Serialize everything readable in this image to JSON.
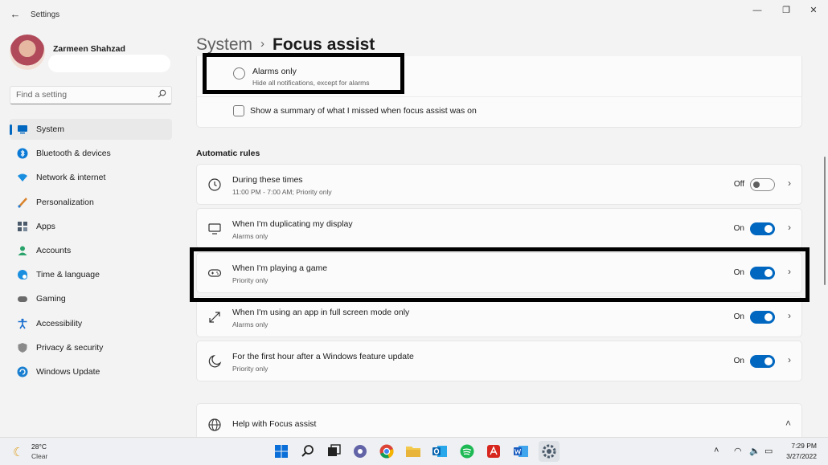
{
  "window": {
    "app_title": "Settings",
    "back_glyph": "←",
    "minimize_glyph": "—",
    "restore_glyph": "❐",
    "close_glyph": "✕"
  },
  "user": {
    "name": "Zarmeen Shahzad"
  },
  "search": {
    "placeholder": "Find a setting",
    "icon": "search-icon"
  },
  "nav": {
    "items": [
      {
        "label": "System",
        "icon": "monitor-icon",
        "color": "#0067c0",
        "active": true
      },
      {
        "label": "Bluetooth & devices",
        "icon": "bluetooth-icon",
        "color": "#0a7ad6"
      },
      {
        "label": "Network & internet",
        "icon": "wifi-icon",
        "color": "#1a8fe0"
      },
      {
        "label": "Personalization",
        "icon": "brush-icon",
        "color": "#d9822b"
      },
      {
        "label": "Apps",
        "icon": "apps-icon",
        "color": "#4a5a6a"
      },
      {
        "label": "Accounts",
        "icon": "person-icon",
        "color": "#2aa36b"
      },
      {
        "label": "Time & language",
        "icon": "globe-clock-icon",
        "color": "#1a8fe0"
      },
      {
        "label": "Gaming",
        "icon": "controller-icon",
        "color": "#6a6a6a"
      },
      {
        "label": "Accessibility",
        "icon": "accessibility-icon",
        "color": "#1a6fd0"
      },
      {
        "label": "Privacy & security",
        "icon": "shield-icon",
        "color": "#8a8a8a"
      },
      {
        "label": "Windows Update",
        "icon": "update-icon",
        "color": "#1a7fd0"
      }
    ]
  },
  "header": {
    "parent": "System",
    "separator": "›",
    "current": "Focus assist"
  },
  "priority_options": {
    "alarms_title": "Alarms only",
    "alarms_sub": "Hide all notifications, except for alarms",
    "summary_label": "Show a summary of what I missed when focus assist was on"
  },
  "automatic_rules": {
    "title": "Automatic rules",
    "rules": [
      {
        "title": "During these times",
        "sub": "11:00 PM - 7:00 AM; Priority only",
        "state": "Off",
        "on": false,
        "icon": "clock-icon"
      },
      {
        "title": "When I'm duplicating my display",
        "sub": "Alarms only",
        "state": "On",
        "on": true,
        "icon": "display-icon"
      },
      {
        "title": "When I'm playing a game",
        "sub": "Priority only",
        "state": "On",
        "on": true,
        "icon": "gamepad-icon"
      },
      {
        "title": "When I'm using an app in full screen mode only",
        "sub": "Alarms only",
        "state": "On",
        "on": true,
        "icon": "fullscreen-icon"
      },
      {
        "title": "For the first hour after a Windows feature update",
        "sub": "Priority only",
        "state": "On",
        "on": true,
        "icon": "moon-icon"
      }
    ]
  },
  "help": {
    "title": "Help with Focus assist",
    "icon": "globe-icon"
  },
  "chevron_right": "›",
  "chevron_up": "˄",
  "taskbar": {
    "weather_temp": "28°C",
    "weather_desc": "Clear",
    "apps": [
      "windows-start-icon",
      "search-icon",
      "task-view-icon",
      "teams-chat-icon",
      "chrome-icon",
      "file-explorer-icon",
      "outlook-icon",
      "spotify-icon",
      "acrobat-icon",
      "word-icon",
      "settings-icon"
    ],
    "tray_glyphs": {
      "up": "˄",
      "wifi": "◠",
      "volume": "🔈",
      "battery": "▭"
    },
    "time": "7:29 PM",
    "date": "3/27/2022"
  }
}
